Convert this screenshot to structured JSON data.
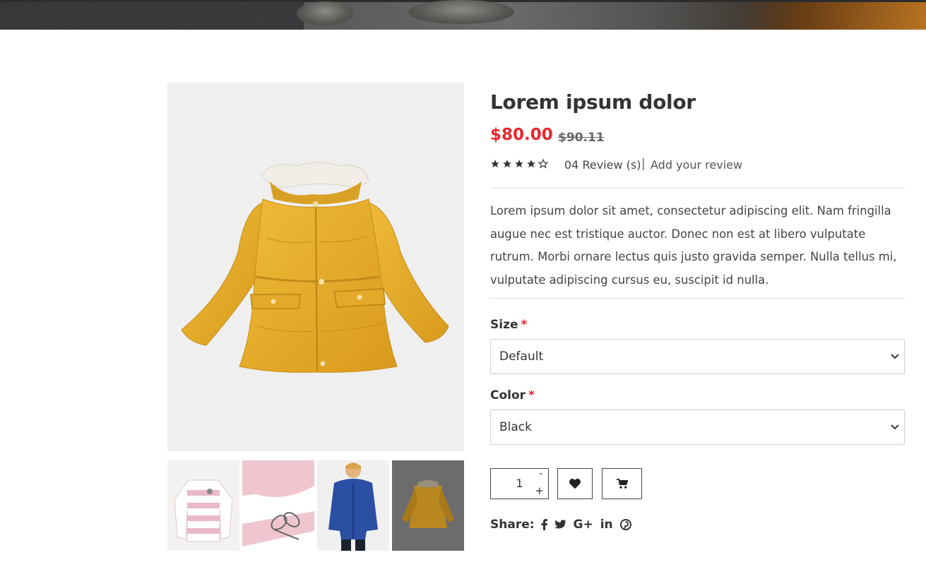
{
  "product": {
    "title": "Lorem ipsum dolor",
    "price": "$80.00",
    "old_price": "$90.11",
    "rating": 4,
    "rating_max": 5,
    "review_count_label": "04 Review (s)",
    "review_separator": "|",
    "add_review_label": "Add your review",
    "description": "Lorem ipsum dolor sit amet, consectetur adipiscing elit. Nam fringilla augue nec est tristique auctor. Donec non est at libero vulputate rutrum. Morbi ornare lectus quis justo gravida semper. Nulla tellus mi, vulputate adipiscing cursus eu, suscipit id nulla."
  },
  "options": {
    "size": {
      "label": "Size",
      "required_mark": "*",
      "selected": "Default"
    },
    "color": {
      "label": "Color",
      "required_mark": "*",
      "selected": "Black"
    }
  },
  "quantity": {
    "value": "1",
    "minus_label": "-",
    "plus_label": "+"
  },
  "share": {
    "label": "Share:",
    "networks": [
      "facebook-icon",
      "twitter-icon",
      "google-plus-icon",
      "linkedin-icon",
      "pinterest-icon"
    ],
    "google_plus_text": "G+",
    "linkedin_text": "in"
  },
  "thumbnails": [
    "striped-sweater",
    "sweater-closeup",
    "boy-blue-jacket",
    "yellow-jacket-dark"
  ],
  "colors": {
    "accent_red": "#e8262e",
    "text_dark": "#333333",
    "jacket_yellow": "#e5ad29",
    "image_bg": "#efefef"
  }
}
